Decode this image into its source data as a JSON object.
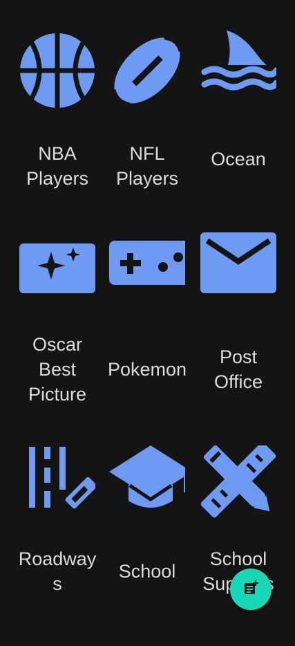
{
  "theme": {
    "background": "#141414",
    "icon_color": "#6f9af2",
    "label_color": "#dcdcdc",
    "fab_color": "#19d8b8"
  },
  "categories": [
    {
      "label": "NBA\nPlayers",
      "icon": "basketball-icon"
    },
    {
      "label": "NFL\nPlayers",
      "icon": "football-icon"
    },
    {
      "label": "Ocean",
      "icon": "shark-fin-waves-icon"
    },
    {
      "label": "Oscar\nBest\nPicture",
      "icon": "clapperboard-icon"
    },
    {
      "label": "Pokemon",
      "icon": "gamepad-icon"
    },
    {
      "label": "Post\nOffice",
      "icon": "envelope-icon"
    },
    {
      "label": "Roadway\ns",
      "icon": "road-pencil-icon"
    },
    {
      "label": "School",
      "icon": "graduation-cap-icon"
    },
    {
      "label": "School\nSupplies",
      "icon": "pencil-ruler-icon"
    }
  ],
  "fab": {
    "icon": "new-note-icon"
  }
}
